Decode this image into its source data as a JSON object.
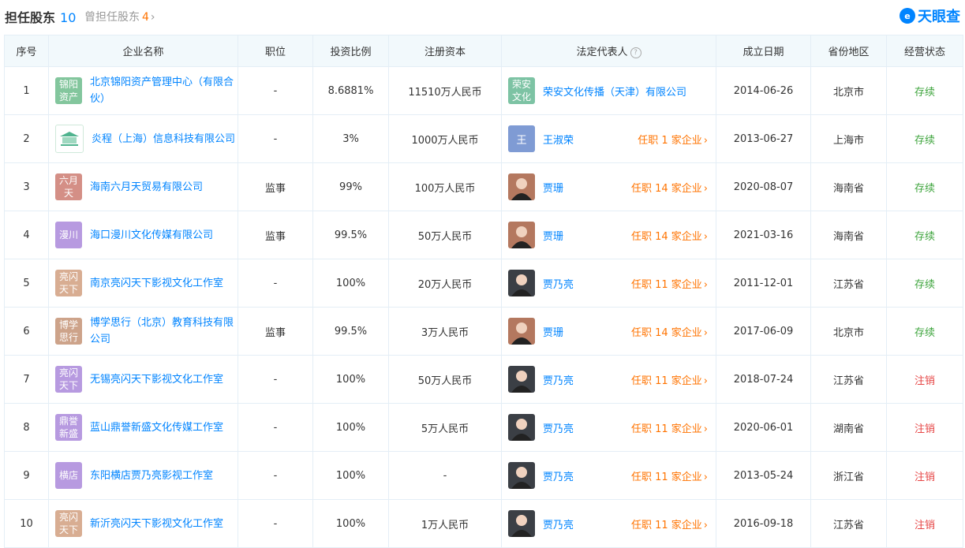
{
  "header": {
    "current_label": "担任股东",
    "current_count": "10",
    "former_label": "曾担任股东",
    "former_count": "4",
    "brand": "天眼查"
  },
  "columns": {
    "seq": "序号",
    "company": "企业名称",
    "position": "职位",
    "ratio": "投资比例",
    "capital": "注册资本",
    "legal_rep": "法定代表人",
    "date": "成立日期",
    "region": "省份地区",
    "status": "经营状态"
  },
  "colors": {
    "link": "#0084ff",
    "orange": "#ff7300",
    "active": "#3fa53e",
    "cancelled": "#e64545",
    "header_bg": "#f2f9fc"
  },
  "rows": [
    {
      "seq": "1",
      "logo_text": "锦阳资产",
      "logo_color": "#83c69d",
      "name": "北京锦阳资产管理中心（有限合伙）",
      "position": "-",
      "ratio": "8.6881%",
      "capital": "11510万人民币",
      "rep": "荣安文化传播（天津）有限公司",
      "rep_avatar": "荣安文化",
      "rep_avatar_color": "#7dc3a4",
      "rep_jobs": "",
      "date": "2014-06-26",
      "region": "北京市",
      "status": "存续",
      "status_type": "ok"
    },
    {
      "seq": "2",
      "logo_text": "",
      "logo_color": "#ffffff",
      "name": "炎程（上海）信息科技有限公司",
      "position": "-",
      "ratio": "3%",
      "capital": "1000万人民币",
      "rep": "王淑荣",
      "rep_avatar": "王",
      "rep_avatar_color": "#7f9bd4",
      "rep_jobs": "任职 1 家企业",
      "date": "2013-06-27",
      "region": "上海市",
      "status": "存续",
      "status_type": "ok"
    },
    {
      "seq": "3",
      "logo_text": "六月天",
      "logo_color": "#d48f86",
      "name": "海南六月天贸易有限公司",
      "position": "监事",
      "ratio": "99%",
      "capital": "100万人民币",
      "rep": "贾珊",
      "rep_avatar": "",
      "rep_avatar_color": "#b4785f",
      "rep_jobs": "任职 14 家企业",
      "date": "2020-08-07",
      "region": "海南省",
      "status": "存续",
      "status_type": "ok"
    },
    {
      "seq": "4",
      "logo_text": "漫川",
      "logo_color": "#b79ae0",
      "name": "海口漫川文化传媒有限公司",
      "position": "监事",
      "ratio": "99.5%",
      "capital": "50万人民币",
      "rep": "贾珊",
      "rep_avatar": "",
      "rep_avatar_color": "#b4785f",
      "rep_jobs": "任职 14 家企业",
      "date": "2021-03-16",
      "region": "海南省",
      "status": "存续",
      "status_type": "ok"
    },
    {
      "seq": "5",
      "logo_text": "亮闪天下",
      "logo_color": "#d8ad92",
      "name": "南京亮闪天下影视文化工作室",
      "position": "-",
      "ratio": "100%",
      "capital": "20万人民币",
      "rep": "贾乃亮",
      "rep_avatar": "",
      "rep_avatar_color": "#3b3f45",
      "rep_jobs": "任职 11 家企业",
      "date": "2011-12-01",
      "region": "江苏省",
      "status": "存续",
      "status_type": "ok"
    },
    {
      "seq": "6",
      "logo_text": "博学思行",
      "logo_color": "#cda38a",
      "name": "博学思行（北京）教育科技有限公司",
      "position": "监事",
      "ratio": "99.5%",
      "capital": "3万人民币",
      "rep": "贾珊",
      "rep_avatar": "",
      "rep_avatar_color": "#b4785f",
      "rep_jobs": "任职 14 家企业",
      "date": "2017-06-09",
      "region": "北京市",
      "status": "存续",
      "status_type": "ok"
    },
    {
      "seq": "7",
      "logo_text": "亮闪天下",
      "logo_color": "#b79ae0",
      "name": "无锡亮闪天下影视文化工作室",
      "position": "-",
      "ratio": "100%",
      "capital": "50万人民币",
      "rep": "贾乃亮",
      "rep_avatar": "",
      "rep_avatar_color": "#3b3f45",
      "rep_jobs": "任职 11 家企业",
      "date": "2018-07-24",
      "region": "江苏省",
      "status": "注销",
      "status_type": "no"
    },
    {
      "seq": "8",
      "logo_text": "鼎誉新盛",
      "logo_color": "#b79ae0",
      "name": "蓝山鼎誉新盛文化传媒工作室",
      "position": "-",
      "ratio": "100%",
      "capital": "5万人民币",
      "rep": "贾乃亮",
      "rep_avatar": "",
      "rep_avatar_color": "#3b3f45",
      "rep_jobs": "任职 11 家企业",
      "date": "2020-06-01",
      "region": "湖南省",
      "status": "注销",
      "status_type": "no"
    },
    {
      "seq": "9",
      "logo_text": "横店",
      "logo_color": "#b79ae0",
      "name": "东阳横店贾乃亮影视工作室",
      "position": "-",
      "ratio": "100%",
      "capital": "-",
      "rep": "贾乃亮",
      "rep_avatar": "",
      "rep_avatar_color": "#3b3f45",
      "rep_jobs": "任职 11 家企业",
      "date": "2013-05-24",
      "region": "浙江省",
      "status": "注销",
      "status_type": "no"
    },
    {
      "seq": "10",
      "logo_text": "亮闪天下",
      "logo_color": "#d8ad92",
      "name": "新沂亮闪天下影视文化工作室",
      "position": "-",
      "ratio": "100%",
      "capital": "1万人民币",
      "rep": "贾乃亮",
      "rep_avatar": "",
      "rep_avatar_color": "#3b3f45",
      "rep_jobs": "任职 11 家企业",
      "date": "2016-09-18",
      "region": "江苏省",
      "status": "注销",
      "status_type": "no"
    }
  ]
}
